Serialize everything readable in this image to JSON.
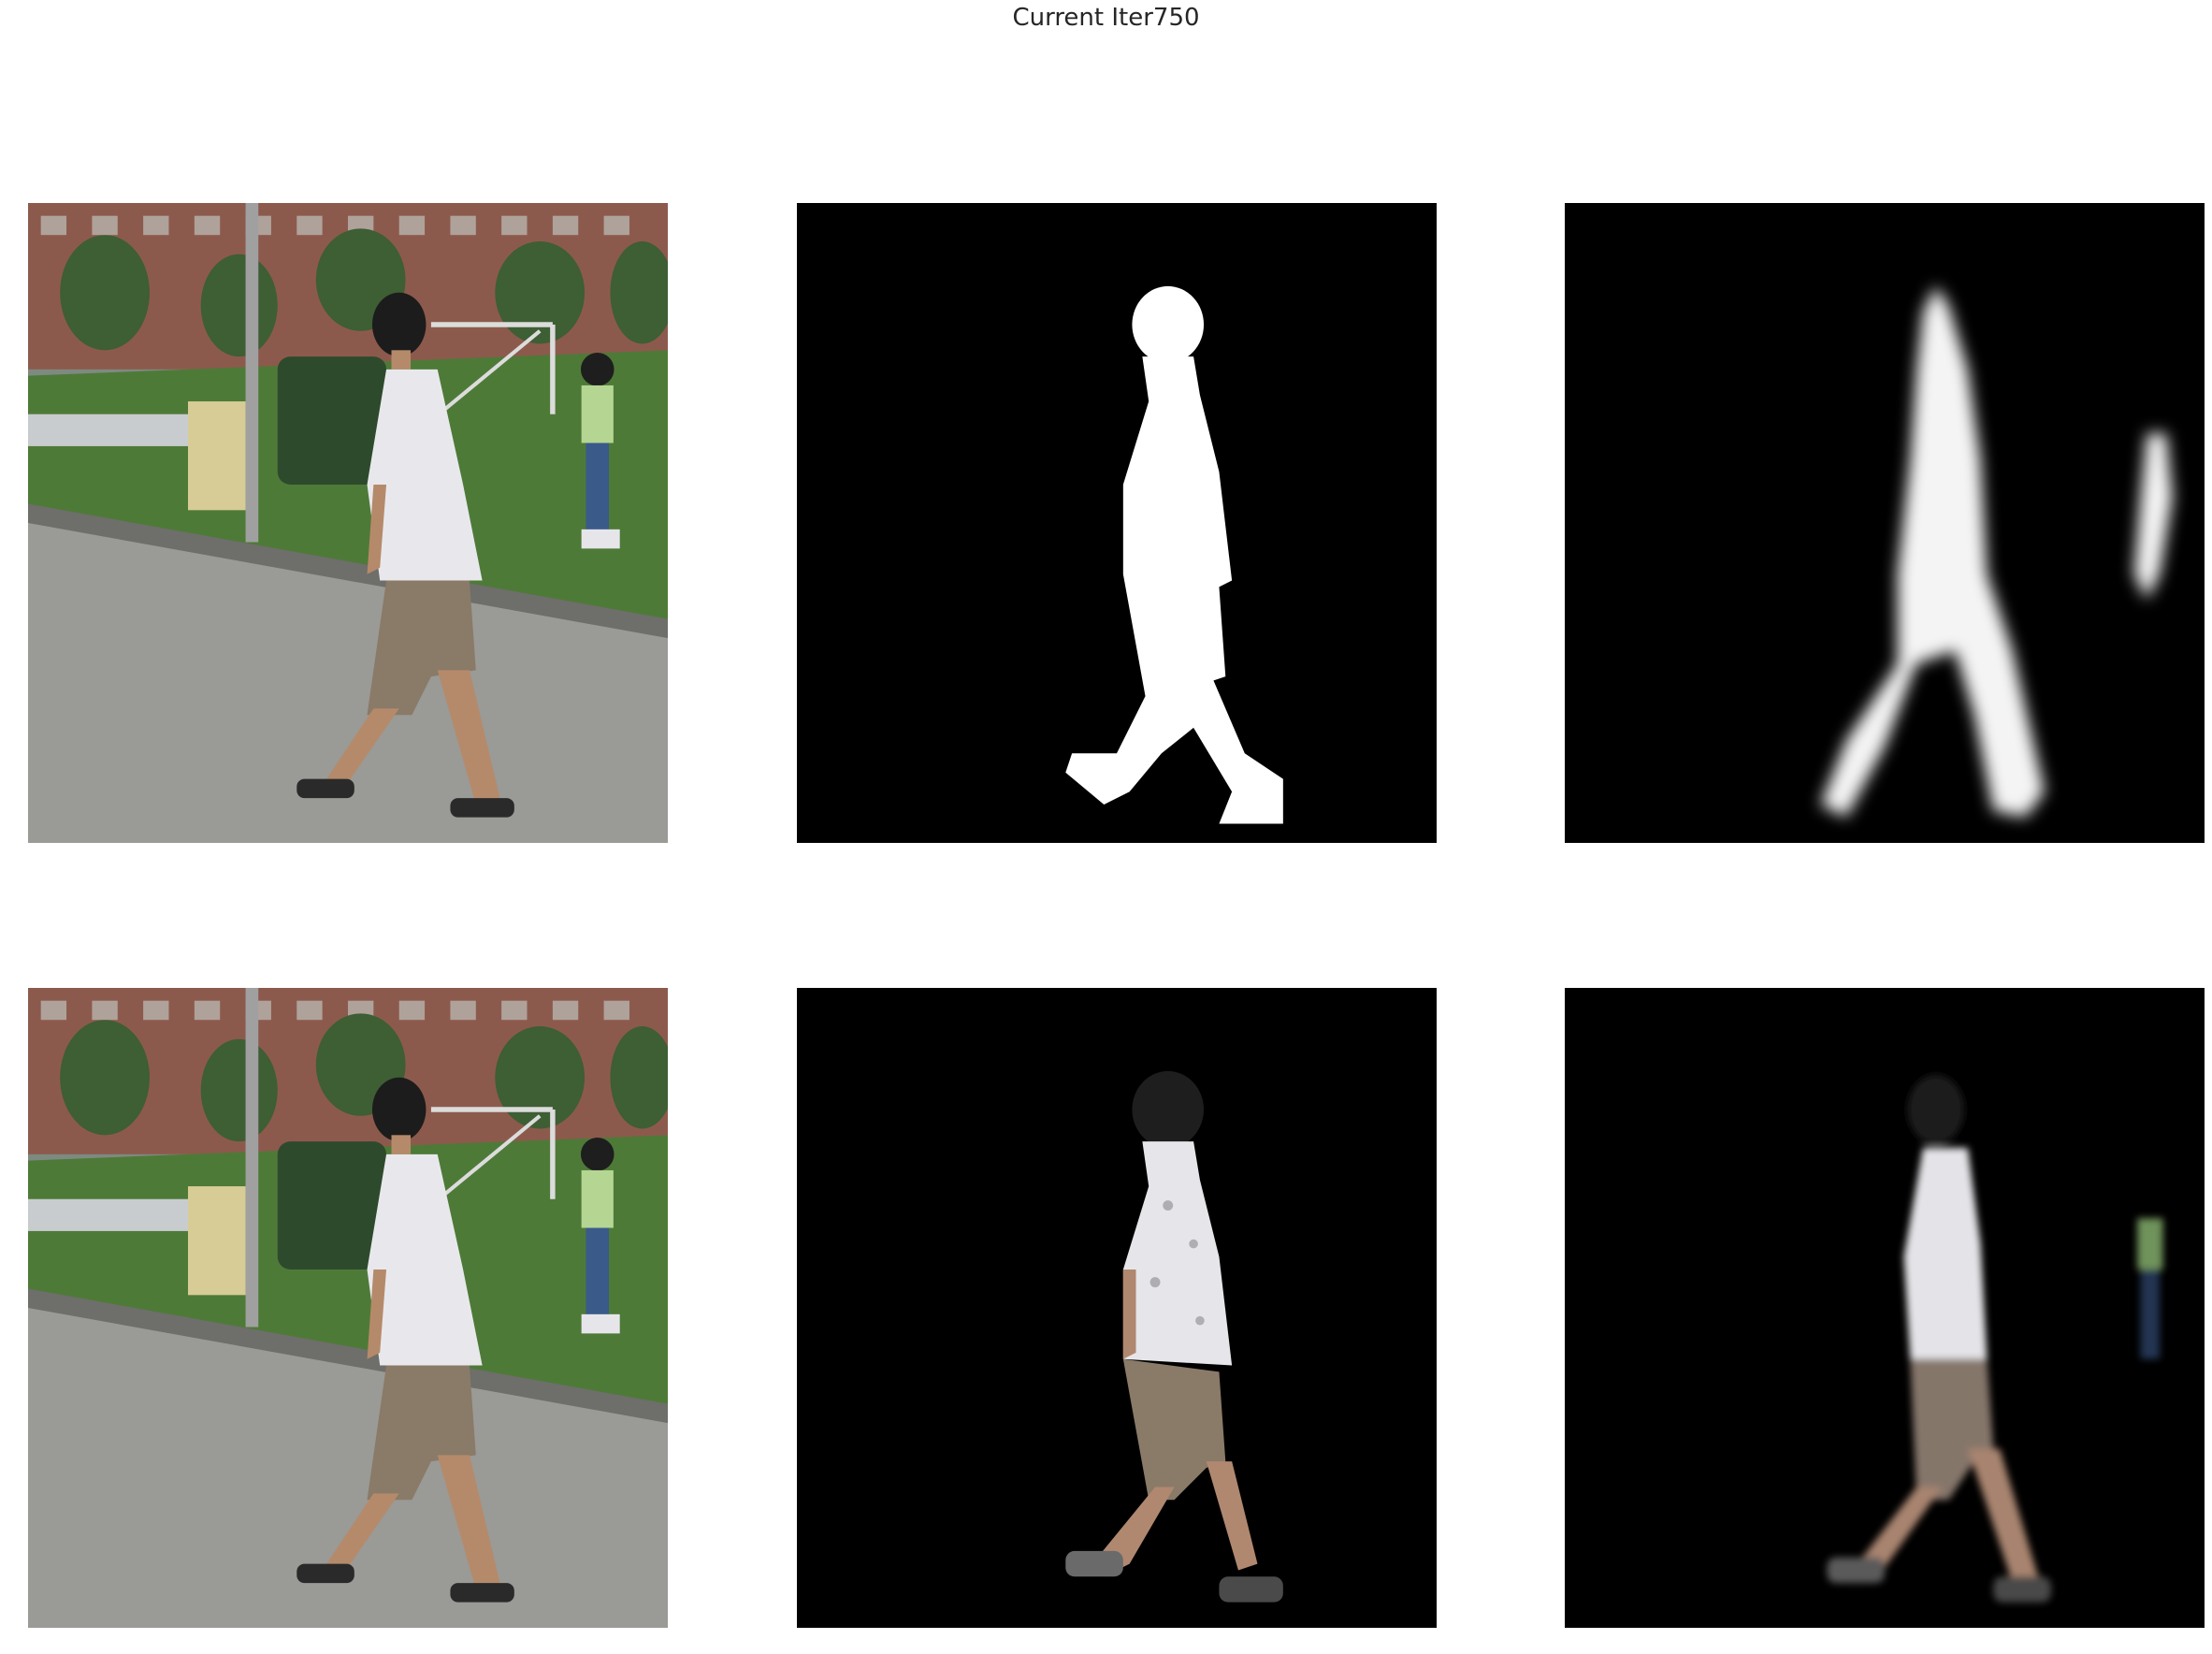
{
  "figure": {
    "title": "Current Iter750"
  },
  "panels": [
    {
      "id": "input-image",
      "kind": "photo"
    },
    {
      "id": "ground-truth-mask",
      "kind": "binary-mask"
    },
    {
      "id": "predicted-mask",
      "kind": "soft-mask"
    },
    {
      "id": "input-image-copy",
      "kind": "photo"
    },
    {
      "id": "ground-truth-masked-image",
      "kind": "masked-photo"
    },
    {
      "id": "predicted-masked-image",
      "kind": "masked-photo"
    }
  ],
  "colors": {
    "background": "#ffffff",
    "mask_background": "#000000",
    "mask_foreground": "#ffffff",
    "grass": "#4f7a3a",
    "road": "#9a9a96",
    "building": "#8a5a4a",
    "shirt": "#e8e8ec",
    "shorts": "#8a7a68",
    "skin": "#b58a6a",
    "hair": "#1c1c1c"
  }
}
